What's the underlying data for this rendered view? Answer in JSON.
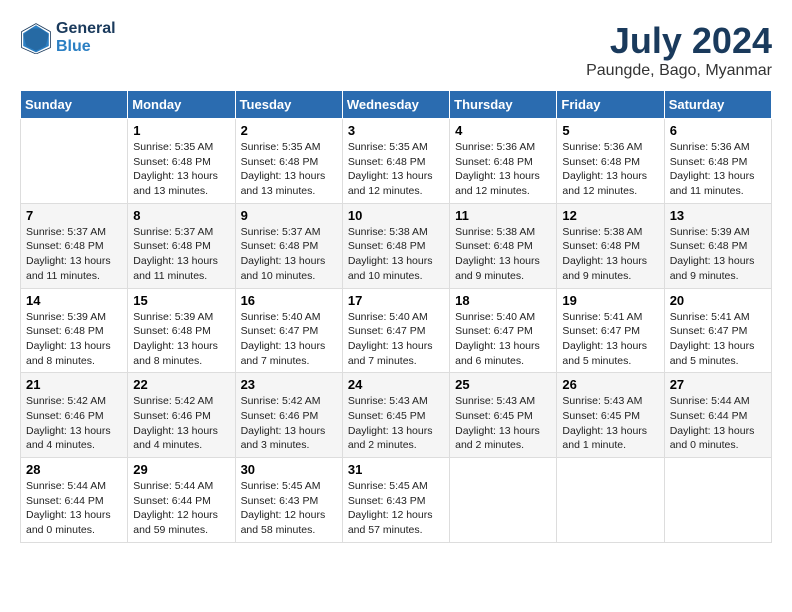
{
  "logo": {
    "line1": "General",
    "line2": "Blue"
  },
  "title": "July 2024",
  "location": "Paungde, Bago, Myanmar",
  "days_of_week": [
    "Sunday",
    "Monday",
    "Tuesday",
    "Wednesday",
    "Thursday",
    "Friday",
    "Saturday"
  ],
  "weeks": [
    [
      {
        "day": "",
        "info": ""
      },
      {
        "day": "1",
        "info": "Sunrise: 5:35 AM\nSunset: 6:48 PM\nDaylight: 13 hours\nand 13 minutes."
      },
      {
        "day": "2",
        "info": "Sunrise: 5:35 AM\nSunset: 6:48 PM\nDaylight: 13 hours\nand 13 minutes."
      },
      {
        "day": "3",
        "info": "Sunrise: 5:35 AM\nSunset: 6:48 PM\nDaylight: 13 hours\nand 12 minutes."
      },
      {
        "day": "4",
        "info": "Sunrise: 5:36 AM\nSunset: 6:48 PM\nDaylight: 13 hours\nand 12 minutes."
      },
      {
        "day": "5",
        "info": "Sunrise: 5:36 AM\nSunset: 6:48 PM\nDaylight: 13 hours\nand 12 minutes."
      },
      {
        "day": "6",
        "info": "Sunrise: 5:36 AM\nSunset: 6:48 PM\nDaylight: 13 hours\nand 11 minutes."
      }
    ],
    [
      {
        "day": "7",
        "info": "Sunrise: 5:37 AM\nSunset: 6:48 PM\nDaylight: 13 hours\nand 11 minutes."
      },
      {
        "day": "8",
        "info": "Sunrise: 5:37 AM\nSunset: 6:48 PM\nDaylight: 13 hours\nand 11 minutes."
      },
      {
        "day": "9",
        "info": "Sunrise: 5:37 AM\nSunset: 6:48 PM\nDaylight: 13 hours\nand 10 minutes."
      },
      {
        "day": "10",
        "info": "Sunrise: 5:38 AM\nSunset: 6:48 PM\nDaylight: 13 hours\nand 10 minutes."
      },
      {
        "day": "11",
        "info": "Sunrise: 5:38 AM\nSunset: 6:48 PM\nDaylight: 13 hours\nand 9 minutes."
      },
      {
        "day": "12",
        "info": "Sunrise: 5:38 AM\nSunset: 6:48 PM\nDaylight: 13 hours\nand 9 minutes."
      },
      {
        "day": "13",
        "info": "Sunrise: 5:39 AM\nSunset: 6:48 PM\nDaylight: 13 hours\nand 9 minutes."
      }
    ],
    [
      {
        "day": "14",
        "info": "Sunrise: 5:39 AM\nSunset: 6:48 PM\nDaylight: 13 hours\nand 8 minutes."
      },
      {
        "day": "15",
        "info": "Sunrise: 5:39 AM\nSunset: 6:48 PM\nDaylight: 13 hours\nand 8 minutes."
      },
      {
        "day": "16",
        "info": "Sunrise: 5:40 AM\nSunset: 6:47 PM\nDaylight: 13 hours\nand 7 minutes."
      },
      {
        "day": "17",
        "info": "Sunrise: 5:40 AM\nSunset: 6:47 PM\nDaylight: 13 hours\nand 7 minutes."
      },
      {
        "day": "18",
        "info": "Sunrise: 5:40 AM\nSunset: 6:47 PM\nDaylight: 13 hours\nand 6 minutes."
      },
      {
        "day": "19",
        "info": "Sunrise: 5:41 AM\nSunset: 6:47 PM\nDaylight: 13 hours\nand 5 minutes."
      },
      {
        "day": "20",
        "info": "Sunrise: 5:41 AM\nSunset: 6:47 PM\nDaylight: 13 hours\nand 5 minutes."
      }
    ],
    [
      {
        "day": "21",
        "info": "Sunrise: 5:42 AM\nSunset: 6:46 PM\nDaylight: 13 hours\nand 4 minutes."
      },
      {
        "day": "22",
        "info": "Sunrise: 5:42 AM\nSunset: 6:46 PM\nDaylight: 13 hours\nand 4 minutes."
      },
      {
        "day": "23",
        "info": "Sunrise: 5:42 AM\nSunset: 6:46 PM\nDaylight: 13 hours\nand 3 minutes."
      },
      {
        "day": "24",
        "info": "Sunrise: 5:43 AM\nSunset: 6:45 PM\nDaylight: 13 hours\nand 2 minutes."
      },
      {
        "day": "25",
        "info": "Sunrise: 5:43 AM\nSunset: 6:45 PM\nDaylight: 13 hours\nand 2 minutes."
      },
      {
        "day": "26",
        "info": "Sunrise: 5:43 AM\nSunset: 6:45 PM\nDaylight: 13 hours\nand 1 minute."
      },
      {
        "day": "27",
        "info": "Sunrise: 5:44 AM\nSunset: 6:44 PM\nDaylight: 13 hours\nand 0 minutes."
      }
    ],
    [
      {
        "day": "28",
        "info": "Sunrise: 5:44 AM\nSunset: 6:44 PM\nDaylight: 13 hours\nand 0 minutes."
      },
      {
        "day": "29",
        "info": "Sunrise: 5:44 AM\nSunset: 6:44 PM\nDaylight: 12 hours\nand 59 minutes."
      },
      {
        "day": "30",
        "info": "Sunrise: 5:45 AM\nSunset: 6:43 PM\nDaylight: 12 hours\nand 58 minutes."
      },
      {
        "day": "31",
        "info": "Sunrise: 5:45 AM\nSunset: 6:43 PM\nDaylight: 12 hours\nand 57 minutes."
      },
      {
        "day": "",
        "info": ""
      },
      {
        "day": "",
        "info": ""
      },
      {
        "day": "",
        "info": ""
      }
    ]
  ]
}
